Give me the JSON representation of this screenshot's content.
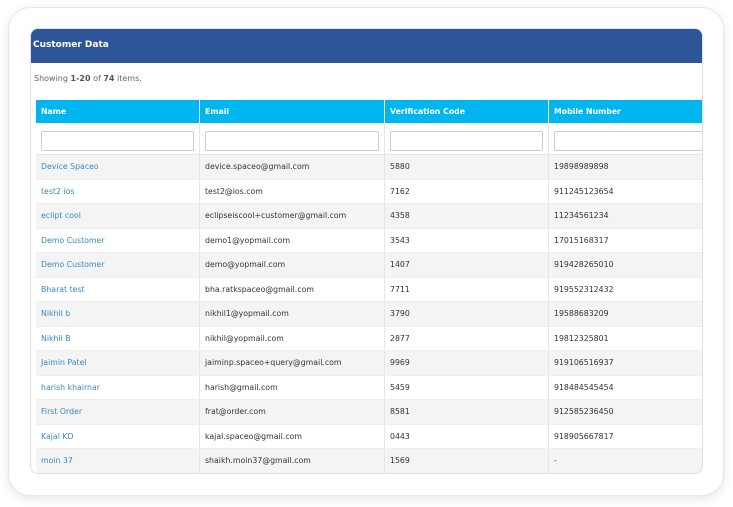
{
  "panel": {
    "title": "Customer Data"
  },
  "summary": {
    "prefix": "Showing ",
    "range": "1-20",
    "middle": " of ",
    "total": "74",
    "suffix": " items."
  },
  "table": {
    "columns": [
      "Name",
      "Email",
      "Verification Code",
      "Mobile Number"
    ],
    "filters": [
      "",
      "",
      "",
      ""
    ],
    "rows": [
      {
        "name": "Device Spaceo",
        "email": "device.spaceo@gmail.com",
        "code": "5880",
        "mobile": "19898989898"
      },
      {
        "name": "test2 ios",
        "email": "test2@ios.com",
        "code": "7162",
        "mobile": "911245123654"
      },
      {
        "name": "eclipt cool",
        "email": "eclipseiscool+customer@gmail.com",
        "code": "4358",
        "mobile": "11234561234"
      },
      {
        "name": "Demo Customer",
        "email": "demo1@yopmail.com",
        "code": "3543",
        "mobile": "17015168317"
      },
      {
        "name": "Demo Customer",
        "email": "demo@yopmail.com",
        "code": "1407",
        "mobile": "919428265010"
      },
      {
        "name": "Bharat test",
        "email": "bha.ratkspaceo@gmail.com",
        "code": "7711",
        "mobile": "919552312432"
      },
      {
        "name": "Nikhil b",
        "email": "nikhil1@yopmail.com",
        "code": "3790",
        "mobile": "19588683209"
      },
      {
        "name": "Nikhil B",
        "email": "nikhil@yopmail.com",
        "code": "2877",
        "mobile": "19812325801"
      },
      {
        "name": "Jaimin Patel",
        "email": "jaiminp.spaceo+query@gmail.com",
        "code": "9969",
        "mobile": "919106516937"
      },
      {
        "name": "harish khairnar",
        "email": "harish@gmail.com",
        "code": "5459",
        "mobile": "918484545454"
      },
      {
        "name": "First Order",
        "email": "frat@order.com",
        "code": "8581",
        "mobile": "912585236450"
      },
      {
        "name": "Kajal KD",
        "email": "kajal.spaceo@gmail.com",
        "code": "0443",
        "mobile": "918905667817"
      },
      {
        "name": "moin 37",
        "email": "shaikh.moin37@gmail.com",
        "code": "1569",
        "mobile": "-"
      }
    ]
  },
  "colors": {
    "header_bg": "#2e5597",
    "table_head_bg": "#00b6f0",
    "link": "#3a87c5"
  }
}
